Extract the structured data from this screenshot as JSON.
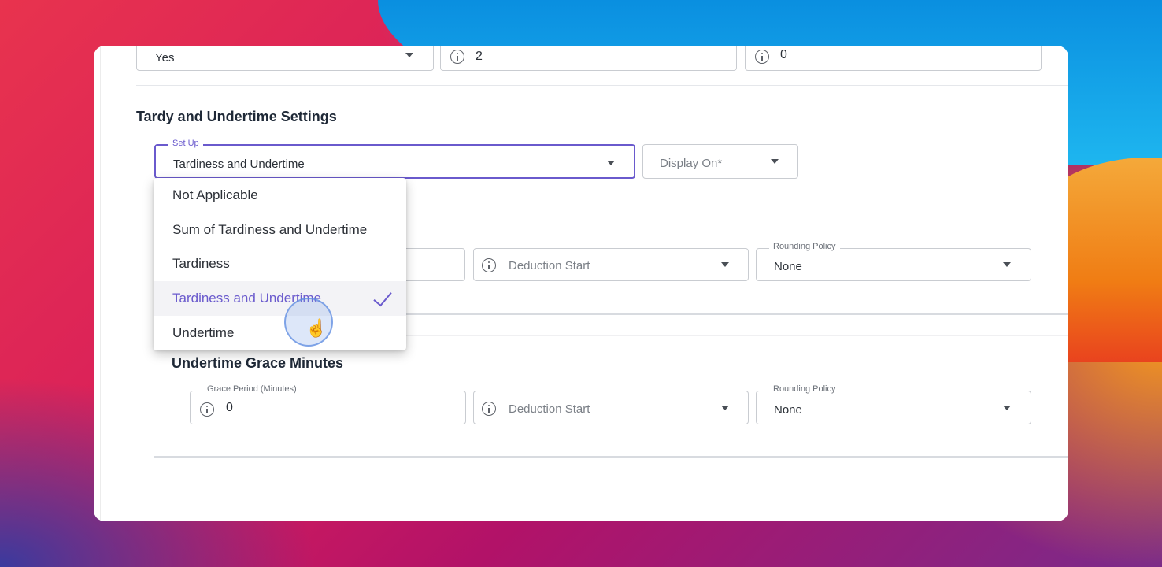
{
  "top_row": {
    "select_value": "Yes",
    "field2_value": "2",
    "field3_value": "0"
  },
  "tardy_section": {
    "title": "Tardy and Undertime Settings",
    "setup_label": "Set Up",
    "setup_value": "Tardiness and Undertime",
    "display_on_placeholder": "Display On*"
  },
  "dropdown": {
    "options": [
      "Not Applicable",
      "Sum of Tardiness and Undertime",
      "Tardiness",
      "Tardiness and Undertime",
      "Undertime"
    ],
    "selected_index": 3
  },
  "tardiness_row": {
    "deduction_placeholder": "Deduction Start",
    "rounding_label": "Rounding Policy",
    "rounding_value": "None"
  },
  "undertime_section": {
    "title": "Undertime Grace Minutes",
    "grace_label": "Grace Period (Minutes)",
    "grace_value": "0",
    "deduction_placeholder": "Deduction Start",
    "rounding_label": "Rounding Policy",
    "rounding_value": "None"
  },
  "colors": {
    "accent": "#6a5acd",
    "border": "#c9ccd1"
  }
}
